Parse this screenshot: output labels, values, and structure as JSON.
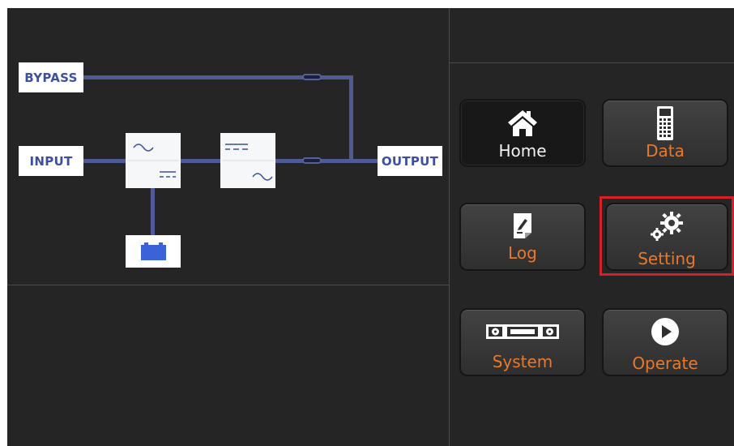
{
  "diagram": {
    "bypass_label": "BYPASS",
    "input_label": "INPUT",
    "output_label": "OUTPUT"
  },
  "menu": {
    "home_label": "Home",
    "data_label": "Data",
    "log_label": "Log",
    "setting_label": "Setting",
    "system_label": "System",
    "operate_label": "Operate",
    "active": "Home",
    "highlighted": "Setting"
  },
  "colors": {
    "screen_bg": "#252525",
    "line": "#4f5a96",
    "label_text": "#3d4f9f",
    "menu_text": "#e8792b",
    "highlight": "#d5202a",
    "battery": "#3b62d8"
  },
  "icons": {
    "home": "home-icon",
    "data": "data-icon",
    "log": "log-icon",
    "setting": "gears-icon",
    "system": "system-icon",
    "operate": "play-icon"
  }
}
